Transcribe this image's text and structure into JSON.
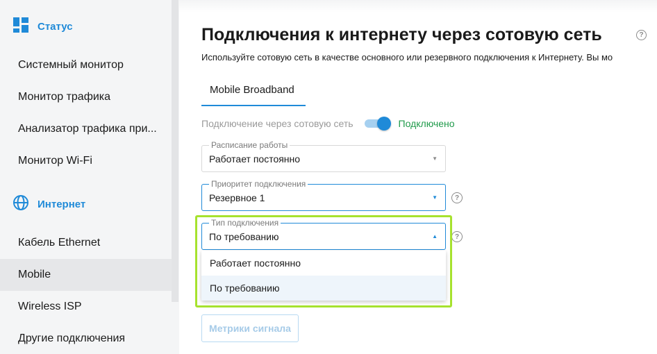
{
  "sidebar": {
    "sections": [
      {
        "label": "Статус",
        "icon": "dashboard-icon"
      },
      {
        "label": "Интернет",
        "icon": "globe-icon"
      }
    ],
    "status_items": [
      {
        "label": "Системный монитор"
      },
      {
        "label": "Монитор трафика"
      },
      {
        "label": "Анализатор трафика при..."
      },
      {
        "label": "Монитор Wi-Fi"
      }
    ],
    "internet_items": [
      {
        "label": "Кабель Ethernet"
      },
      {
        "label": "Mobile",
        "active": true
      },
      {
        "label": "Wireless ISP"
      },
      {
        "label": "Другие подключения"
      }
    ]
  },
  "page": {
    "title": "Подключения к интернету через сотовую сеть",
    "subtitle": "Используйте сотовую сеть в качестве основного или резервного подключения к Интернету. Вы мо",
    "tab_label": "Mobile Broadband"
  },
  "connection": {
    "toggle_label": "Подключение через сотовую сеть",
    "toggle_on": true,
    "status": "Подключено"
  },
  "fields": {
    "schedule": {
      "label": "Расписание работы",
      "value": "Работает постоянно"
    },
    "priority": {
      "label": "Приоритет подключения",
      "value": "Резервное 1"
    },
    "type": {
      "label": "Тип подключения",
      "value": "По требованию",
      "open": true
    }
  },
  "dropdown": {
    "options": [
      {
        "label": "Работает постоянно"
      },
      {
        "label": "По требованию",
        "selected": true
      }
    ]
  },
  "buttons": {
    "metrics": "Метрики сигнала"
  },
  "colors": {
    "accent": "#1f8ad8",
    "success": "#1f9a4a",
    "highlight": "#a6e22e"
  }
}
